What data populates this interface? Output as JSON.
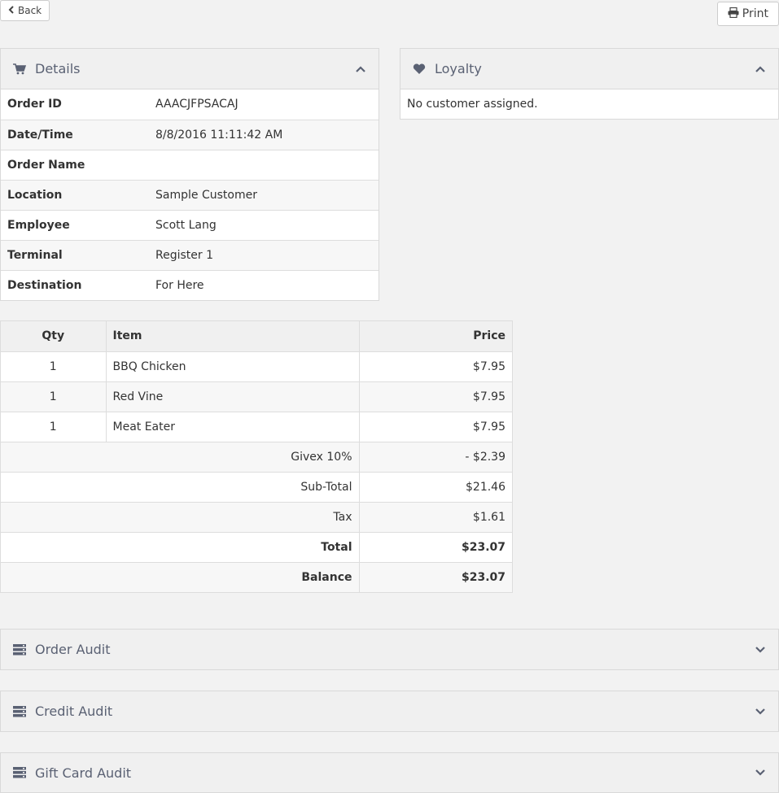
{
  "toolbar": {
    "back_label": "Back",
    "print_label": "Print"
  },
  "details": {
    "title": "Details",
    "rows": [
      {
        "label": "Order ID",
        "value": "AAACJFPSACAJ"
      },
      {
        "label": "Date/Time",
        "value": "8/8/2016 11:11:42 AM"
      },
      {
        "label": "Order Name",
        "value": ""
      },
      {
        "label": "Location",
        "value": "Sample Customer"
      },
      {
        "label": "Employee",
        "value": "Scott Lang"
      },
      {
        "label": "Terminal",
        "value": "Register 1"
      },
      {
        "label": "Destination",
        "value": "For Here"
      }
    ]
  },
  "loyalty": {
    "title": "Loyalty",
    "message": "No customer assigned."
  },
  "order_items": {
    "headers": {
      "qty": "Qty",
      "item": "Item",
      "price": "Price"
    },
    "rows": [
      {
        "qty": "1",
        "item": "BBQ Chicken",
        "price": "$7.95"
      },
      {
        "qty": "1",
        "item": "Red Vine",
        "price": "$7.95"
      },
      {
        "qty": "1",
        "item": "Meat Eater",
        "price": "$7.95"
      }
    ],
    "summary": [
      {
        "label": "Givex 10%",
        "value": "- $2.39"
      },
      {
        "label": "Sub-Total",
        "value": "$21.46"
      },
      {
        "label": "Tax",
        "value": "$1.61"
      },
      {
        "label": "Total",
        "value": "$23.07"
      },
      {
        "label": "Balance",
        "value": "$23.07"
      }
    ]
  },
  "audits": [
    {
      "title": "Order Audit"
    },
    {
      "title": "Credit Audit"
    },
    {
      "title": "Gift Card Audit"
    }
  ],
  "colors": {
    "header_text": "#5a6173",
    "panel_heading_bg": "#f0f0f0",
    "page_bg": "#f2f2f2"
  }
}
